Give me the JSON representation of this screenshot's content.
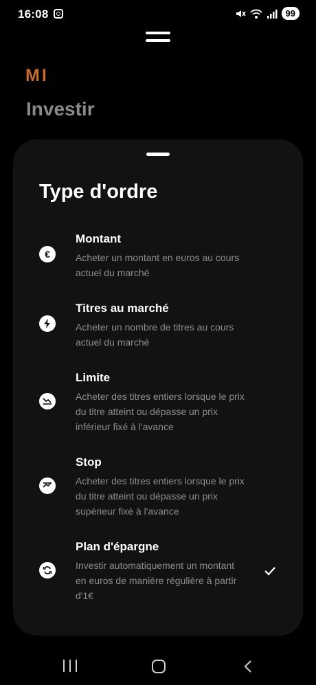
{
  "status_bar": {
    "time": "16:08",
    "battery": "99",
    "icons": [
      "instagram-icon",
      "mute-icon",
      "wifi-icon",
      "signal-icon"
    ]
  },
  "background": {
    "logo": "MI",
    "title": "Investir"
  },
  "sheet": {
    "title": "Type d'ordre",
    "options": [
      {
        "title": "Montant",
        "description": "Acheter un montant en euros au cours actuel du marché",
        "icon": "euro-icon",
        "selected": false
      },
      {
        "title": "Titres au marché",
        "description": "Acheter un nombre de titres au cours actuel du marché",
        "icon": "lightning-icon",
        "selected": false
      },
      {
        "title": "Limite",
        "description": "Acheter des titres entiers lorsque le prix du titre atteint ou dépasse un prix inférieur fixé à l'avance",
        "icon": "trend-down-icon",
        "selected": false
      },
      {
        "title": "Stop",
        "description": "Acheter des titres entiers lorsque le prix du titre atteint ou dépasse un prix supérieur fixé à l'avance",
        "icon": "trend-up-icon",
        "selected": false
      },
      {
        "title": "Plan d'épargne",
        "description": "Investir automatiquement un montant en euros de manière régulière à partir d'1€",
        "icon": "recurring-icon",
        "selected": true
      }
    ]
  },
  "colors": {
    "sheet_bg": "#121212",
    "logo_accent": "#c76a2e",
    "muted_text": "#8d8d8d"
  }
}
